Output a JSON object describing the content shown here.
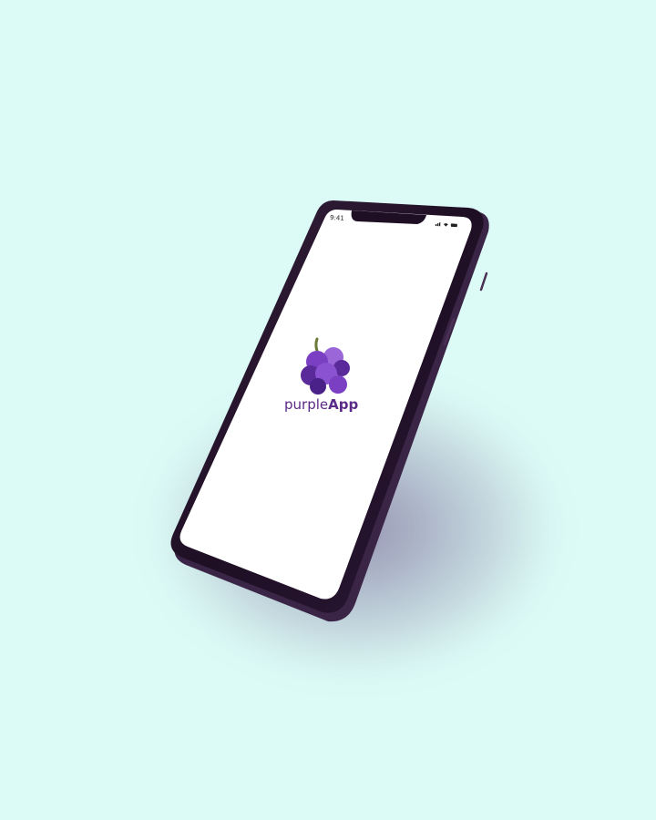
{
  "status_bar": {
    "time": "9:41"
  },
  "splash": {
    "brand_light": "purple",
    "brand_bold": "App",
    "logo_icon": "grape-icon"
  },
  "colors": {
    "background": "#dcfbf6",
    "phone_frame": "#24132d",
    "screen": "#ffffff",
    "brand": "#5b2a86",
    "grape_dark": "#5a2a9a",
    "grape_mid": "#7b3fc4",
    "grape_light": "#9a66d8",
    "stem": "#6b7a3a"
  }
}
